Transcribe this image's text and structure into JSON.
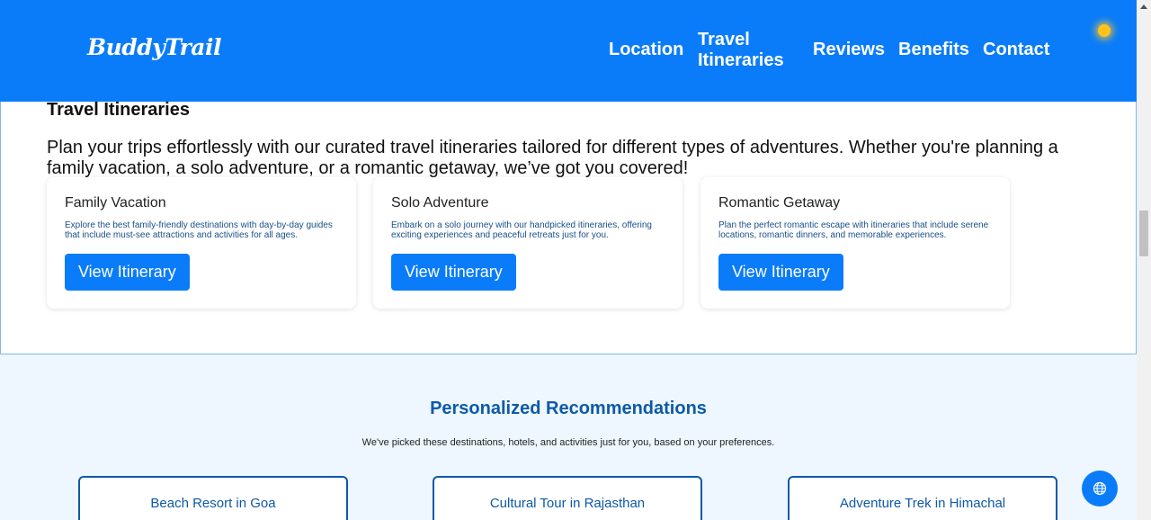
{
  "header": {
    "logo": "BuddyTrail",
    "nav": [
      {
        "label": "Location"
      },
      {
        "label": "Travel Itineraries"
      },
      {
        "label": "Reviews"
      },
      {
        "label": "Benefits"
      },
      {
        "label": "Contact"
      }
    ],
    "theme_icon": "sun-icon"
  },
  "itineraries": {
    "title": "Travel Itineraries",
    "intro": "Plan your trips effortlessly with our curated travel itineraries tailored for different types of adventures. Whether you're planning a family vacation, a solo adventure, or a romantic getaway, we’ve got you covered!",
    "cards": [
      {
        "title": "Family Vacation",
        "text": "Explore the best family-friendly destinations with day-by-day guides that include must-see attractions and activities for all ages.",
        "button": "View Itinerary"
      },
      {
        "title": "Solo Adventure",
        "text": "Embark on a solo journey with our handpicked itineraries, offering exciting experiences and peaceful retreats just for you.",
        "button": "View Itinerary"
      },
      {
        "title": "Romantic Getaway",
        "text": "Plan the perfect romantic escape with itineraries that include serene locations, romantic dinners, and memorable experiences.",
        "button": "View Itinerary"
      }
    ]
  },
  "recommendations": {
    "title": "Personalized Recommendations",
    "subtitle": "We've picked these destinations, hotels, and activities just for you, based on your preferences.",
    "cards": [
      {
        "label": "Beach Resort in Goa"
      },
      {
        "label": "Cultural Tour in Rajasthan"
      },
      {
        "label": "Adventure Trek in Himachal"
      }
    ]
  },
  "floating": {
    "icon": "globe-icon"
  },
  "colors": {
    "primary": "#0a7cf9",
    "accent_text": "#0d5aa7",
    "sun": "#ffc21a",
    "page_bg": "#eef7ff"
  }
}
